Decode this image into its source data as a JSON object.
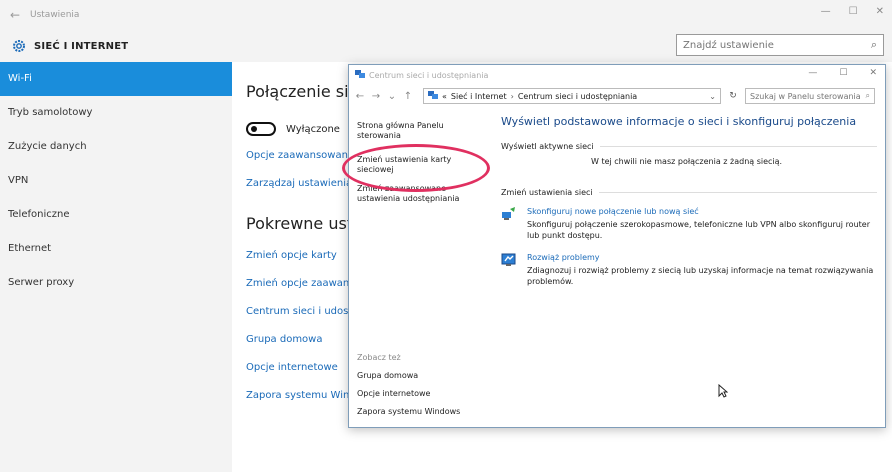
{
  "titlebar": {
    "back": "←",
    "app": "Ustawienia",
    "minimize": "—",
    "maximize": "☐",
    "close": "✕"
  },
  "header": {
    "title": "SIEĆ I INTERNET",
    "search_placeholder": "Znajdź ustawienie"
  },
  "sidebar": {
    "items": [
      {
        "label": "Wi-Fi"
      },
      {
        "label": "Tryb samolotowy"
      },
      {
        "label": "Zużycie danych"
      },
      {
        "label": "VPN"
      },
      {
        "label": "Telefoniczne"
      },
      {
        "label": "Ethernet"
      },
      {
        "label": "Serwer proxy"
      }
    ]
  },
  "content": {
    "heading1": "Połączenie sieć",
    "toggle_label": "Wyłączone",
    "link_advanced": "Opcje zaawansowane",
    "link_manage": "Zarządzaj ustawieniami",
    "heading2": "Pokrewne usta",
    "related": [
      "Zmień opcje karty",
      "Zmień opcje zaawansc",
      "Centrum sieci i udostę",
      "Grupa domowa",
      "Opcje internetowe",
      "Zapora systemu Wind"
    ]
  },
  "cp": {
    "title": "Centrum sieci i udostępniania",
    "winctrls": {
      "minimize": "—",
      "maximize": "☐",
      "close": "✕"
    },
    "nav": {
      "back": "←",
      "forward": "→",
      "down": "⌄",
      "up": "↑"
    },
    "address": {
      "prefix": "«",
      "crumb1": "Sieć i Internet",
      "sep": "›",
      "crumb2": "Centrum sieci i udostępniania",
      "dropdown": "⌄",
      "refresh": "↻"
    },
    "search_placeholder": "Szukaj w Panelu sterowania",
    "left": {
      "home": "Strona główna Panelu sterowania",
      "change_adapter": "Zmień ustawienia karty sieciowej",
      "change_advanced": "Zmień zaawansowane ustawienia udostępniania",
      "see_also_title": "Zobacz też",
      "see_also": [
        "Grupa domowa",
        "Opcje internetowe",
        "Zapora systemu Windows"
      ]
    },
    "main": {
      "heading": "Wyświetl podstawowe informacje o sieci i skonfiguruj połączenia",
      "active_title": "Wyświetl aktywne sieci",
      "no_connection": "W tej chwili nie masz połączenia z żadną siecią.",
      "change_title": "Zmień ustawienia sieci",
      "tasks": [
        {
          "link": "Skonfiguruj nowe połączenie lub nową sieć",
          "desc": "Skonfiguruj połączenie szerokopasmowe, telefoniczne lub VPN albo skonfiguruj router lub punkt dostępu."
        },
        {
          "link": "Rozwiąż problemy",
          "desc": "Zdiagnozuj i rozwiąż problemy z siecią lub uzyskaj informacje na temat rozwiązywania problemów."
        }
      ]
    }
  },
  "colors": {
    "accent": "#1a8ddb",
    "link": "#1a6ab8",
    "highlight": "#e03060"
  },
  "icons": {
    "settings": "gear-icon",
    "search": "search-icon",
    "cursor": "mouse-cursor-icon"
  }
}
